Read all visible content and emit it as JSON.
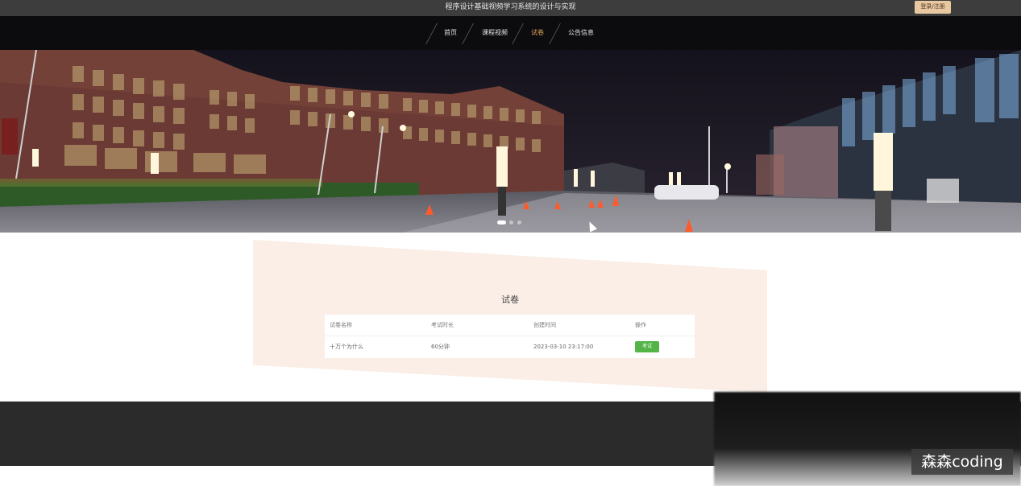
{
  "header": {
    "site_title": "程序设计基础视频学习系统的设计与实现",
    "login_label": "登录/注册"
  },
  "nav": {
    "items": [
      {
        "label": "首页"
      },
      {
        "label": "课程视频"
      },
      {
        "label": "试卷"
      },
      {
        "label": "公告信息"
      }
    ]
  },
  "banner": {
    "image": "night-campus-photo",
    "slides": 3,
    "active_slide": 1
  },
  "section": {
    "title": "试卷",
    "table": {
      "headers": [
        "试卷名称",
        "考试时长",
        "创建时间",
        "操作"
      ],
      "rows": [
        {
          "name": "十万个为什么",
          "duration": "60分钟",
          "created": "2023-03-10 23:17:00",
          "action": "考试"
        }
      ]
    }
  },
  "watermark": "森森coding",
  "colors": {
    "active_nav": "#e0a45a",
    "exam_button": "#54b448",
    "login_button": "#e8c8a0",
    "section_bg": "#faeee6"
  }
}
